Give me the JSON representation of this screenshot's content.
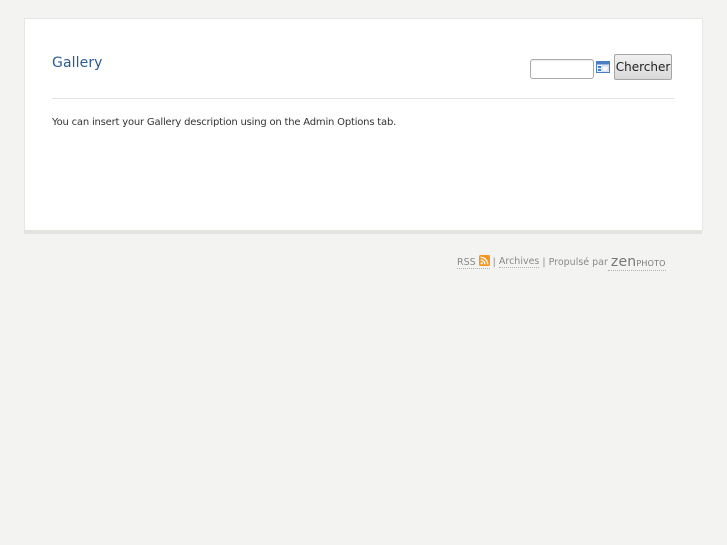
{
  "gallery": {
    "title": "Gallery",
    "description": "You can insert your Gallery description using on the Admin Options tab."
  },
  "search": {
    "input_value": "",
    "button_label": "Chercher",
    "field_icon": "field-selector-icon"
  },
  "footer": {
    "rss_label": "RSS",
    "rss_icon": "rss-icon",
    "separator_1": "|",
    "archives_label": "Archives",
    "separator_2": "|",
    "powered_by_label": "Propulsé par",
    "brand_zen": "zen",
    "brand_photo": "PHOTO"
  },
  "colors": {
    "background": "#f3f3f2",
    "card": "#ffffff",
    "title": "#2b5c96",
    "rss": "#f7941d"
  }
}
